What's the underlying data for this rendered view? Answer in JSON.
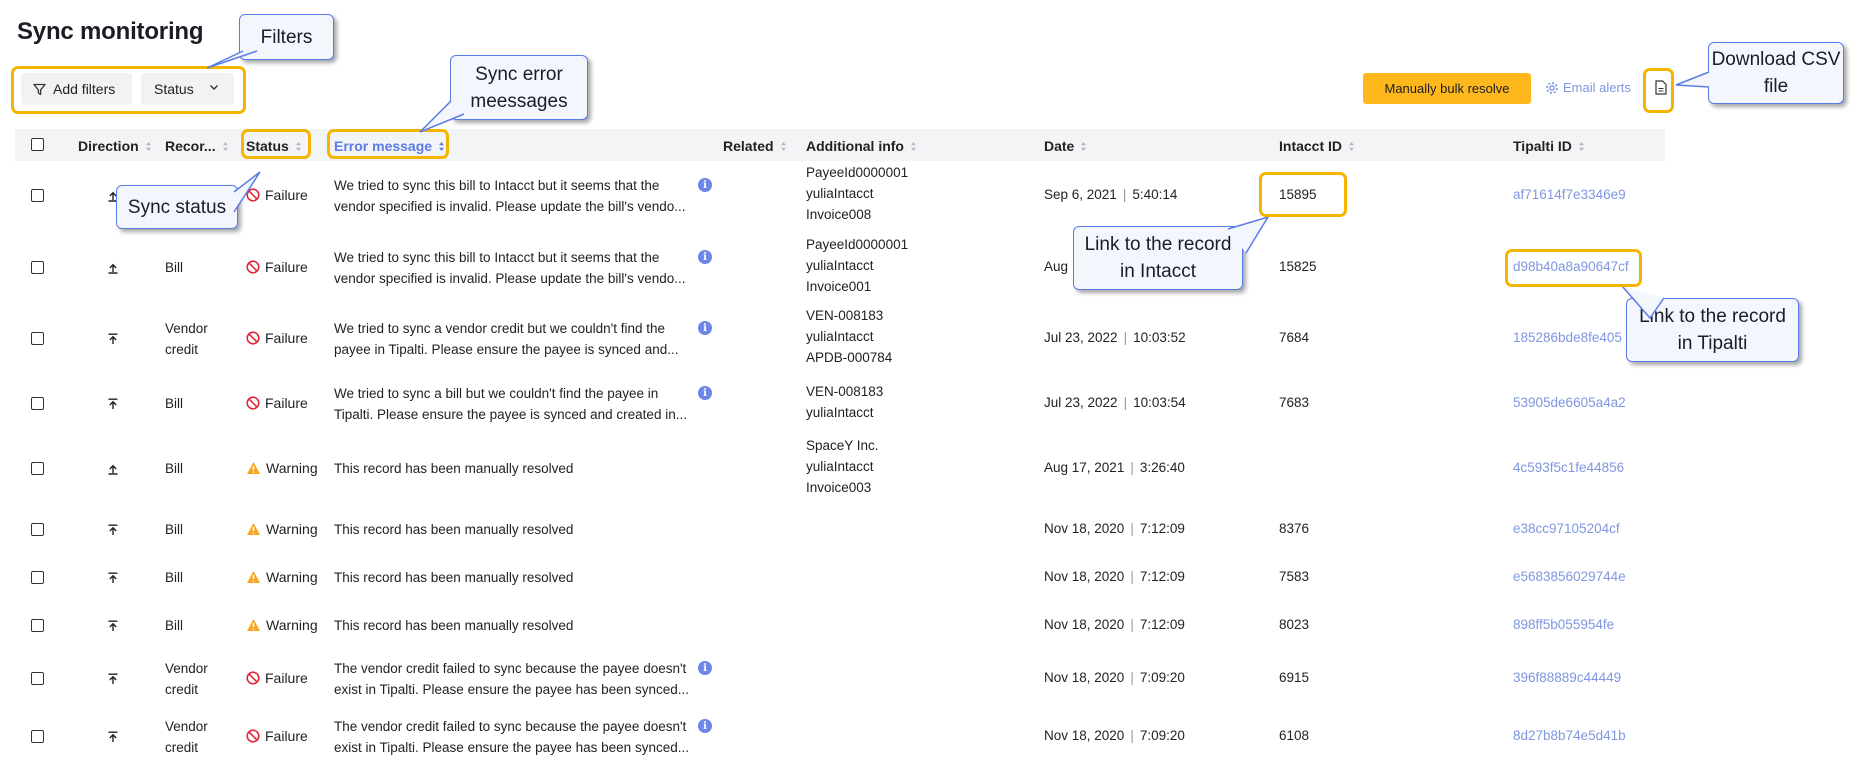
{
  "page": {
    "title": "Sync monitoring"
  },
  "toolbar": {
    "add_filters": "Add filters",
    "status_filter": "Status",
    "bulk_resolve": "Manually bulk resolve",
    "email_alerts": "Email alerts"
  },
  "columns": {
    "direction": "Direction",
    "record": "Recor...",
    "status": "Status",
    "error": "Error message",
    "related": "Related",
    "additional": "Additional info",
    "date": "Date",
    "intacct": "Intacct ID",
    "tipalti": "Tipalti ID"
  },
  "rows": [
    {
      "direction": "up",
      "record": "",
      "status": "Failure",
      "error": "We tried to sync this bill to Intacct but it seems that the vendor specified is invalid. Please update the bill's vendo...",
      "error_l1": "We tried to sync this bill to Intacct but it seems that the",
      "error_l2": "vendor specified is invalid. Please update the bill's vendo...",
      "info": [
        "PayeeId0000001",
        "yuliaIntacct",
        "Invoice008"
      ],
      "date": "Sep 6, 2021",
      "time": "5:40:14",
      "intacct_id": "15895",
      "tipalti_id": "af71614f7e3346e9"
    },
    {
      "direction": "up",
      "record": "Bill",
      "status": "Failure",
      "error_l1": "We tried to sync this bill to Intacct but it seems that the",
      "error_l2": "vendor specified is invalid. Please update the bill's vendo...",
      "info": [
        "PayeeId0000001",
        "yuliaIntacct",
        "Invoice001"
      ],
      "date": "Aug",
      "time": "",
      "intacct_id": "15825",
      "tipalti_id": "d98b40a8a90647cf"
    },
    {
      "direction": "top",
      "record_l1": "Vendor",
      "record_l2": "credit",
      "status": "Failure",
      "error_l1": "We tried to sync a vendor credit but we couldn't find the",
      "error_l2": "payee in Tipalti. Please ensure the payee is synced and...",
      "info": [
        "VEN-008183",
        "yuliaIntacct",
        "APDB-000784"
      ],
      "date": "Jul 23, 2022",
      "time": "10:03:52",
      "intacct_id": "7684",
      "tipalti_id": "185286bde8fe405"
    },
    {
      "direction": "top",
      "record": "Bill",
      "status": "Failure",
      "error_l1": "We tried to sync a bill but we couldn't find the payee in",
      "error_l2": "Tipalti. Please ensure the payee is synced and created in...",
      "info": [
        "VEN-008183",
        "yuliaIntacct"
      ],
      "date": "Jul 23, 2022",
      "time": "10:03:54",
      "intacct_id": "7683",
      "tipalti_id": "53905de6605a4a2"
    },
    {
      "direction": "up",
      "record": "Bill",
      "status": "Warning",
      "error_l1": "This record has been manually resolved",
      "info": [
        "SpaceY Inc.",
        "yuliaIntacct",
        "Invoice003"
      ],
      "date": "Aug 17, 2021",
      "time": "3:26:40",
      "intacct_id": "",
      "tipalti_id": "4c593f5c1fe44856"
    },
    {
      "direction": "top",
      "record": "Bill",
      "status": "Warning",
      "error_l1": "This record has been manually resolved",
      "info": [],
      "date": "Nov 18, 2020",
      "time": "7:12:09",
      "intacct_id": "8376",
      "tipalti_id": "e38cc97105204cf"
    },
    {
      "direction": "top",
      "record": "Bill",
      "status": "Warning",
      "error_l1": "This record has been manually resolved",
      "info": [],
      "date": "Nov 18, 2020",
      "time": "7:12:09",
      "intacct_id": "7583",
      "tipalti_id": "e5683856029744e"
    },
    {
      "direction": "top",
      "record": "Bill",
      "status": "Warning",
      "error_l1": "This record has been manually resolved",
      "info": [],
      "date": "Nov 18, 2020",
      "time": "7:12:09",
      "intacct_id": "8023",
      "tipalti_id": "898ff5b055954fe"
    },
    {
      "direction": "top",
      "record_l1": "Vendor",
      "record_l2": "credit",
      "status": "Failure",
      "error_l1": "The vendor credit failed to sync because the payee doesn't",
      "error_l2": "exist in Tipalti. Please ensure the payee has been synced...",
      "info": [],
      "date": "Nov 18, 2020",
      "time": "7:09:20",
      "intacct_id": "6915",
      "tipalti_id": "396f88889c44449"
    },
    {
      "direction": "top",
      "record_l1": "Vendor",
      "record_l2": "credit",
      "status": "Failure",
      "error_l1": "The vendor credit failed to sync because the payee doesn't",
      "error_l2": "exist in Tipalti. Please ensure the payee has been synced...",
      "info": [],
      "date": "Nov 18, 2020",
      "time": "7:09:20",
      "intacct_id": "6108",
      "tipalti_id": "8d27b8b74e5d41b"
    }
  ],
  "annotations": {
    "filters": "Filters",
    "sync_error_l1": "Sync error",
    "sync_error_l2": "meessages",
    "sync_status": "Sync status",
    "download_l1": "Download CSV",
    "download_l2": "file",
    "link_intacct_l1": "Link to the record",
    "link_intacct_l2": "in Intacct",
    "link_tipalti_l1": "Link to the record",
    "link_tipalti_l2": "in Tipalti"
  },
  "colors": {
    "highlight": "#f5b400",
    "accent_blue": "#5b7ce6",
    "link": "#7f96e0",
    "failure_red": "#e0293b",
    "warning_amber": "#f5a623",
    "bulk_button": "#ffb81c"
  }
}
